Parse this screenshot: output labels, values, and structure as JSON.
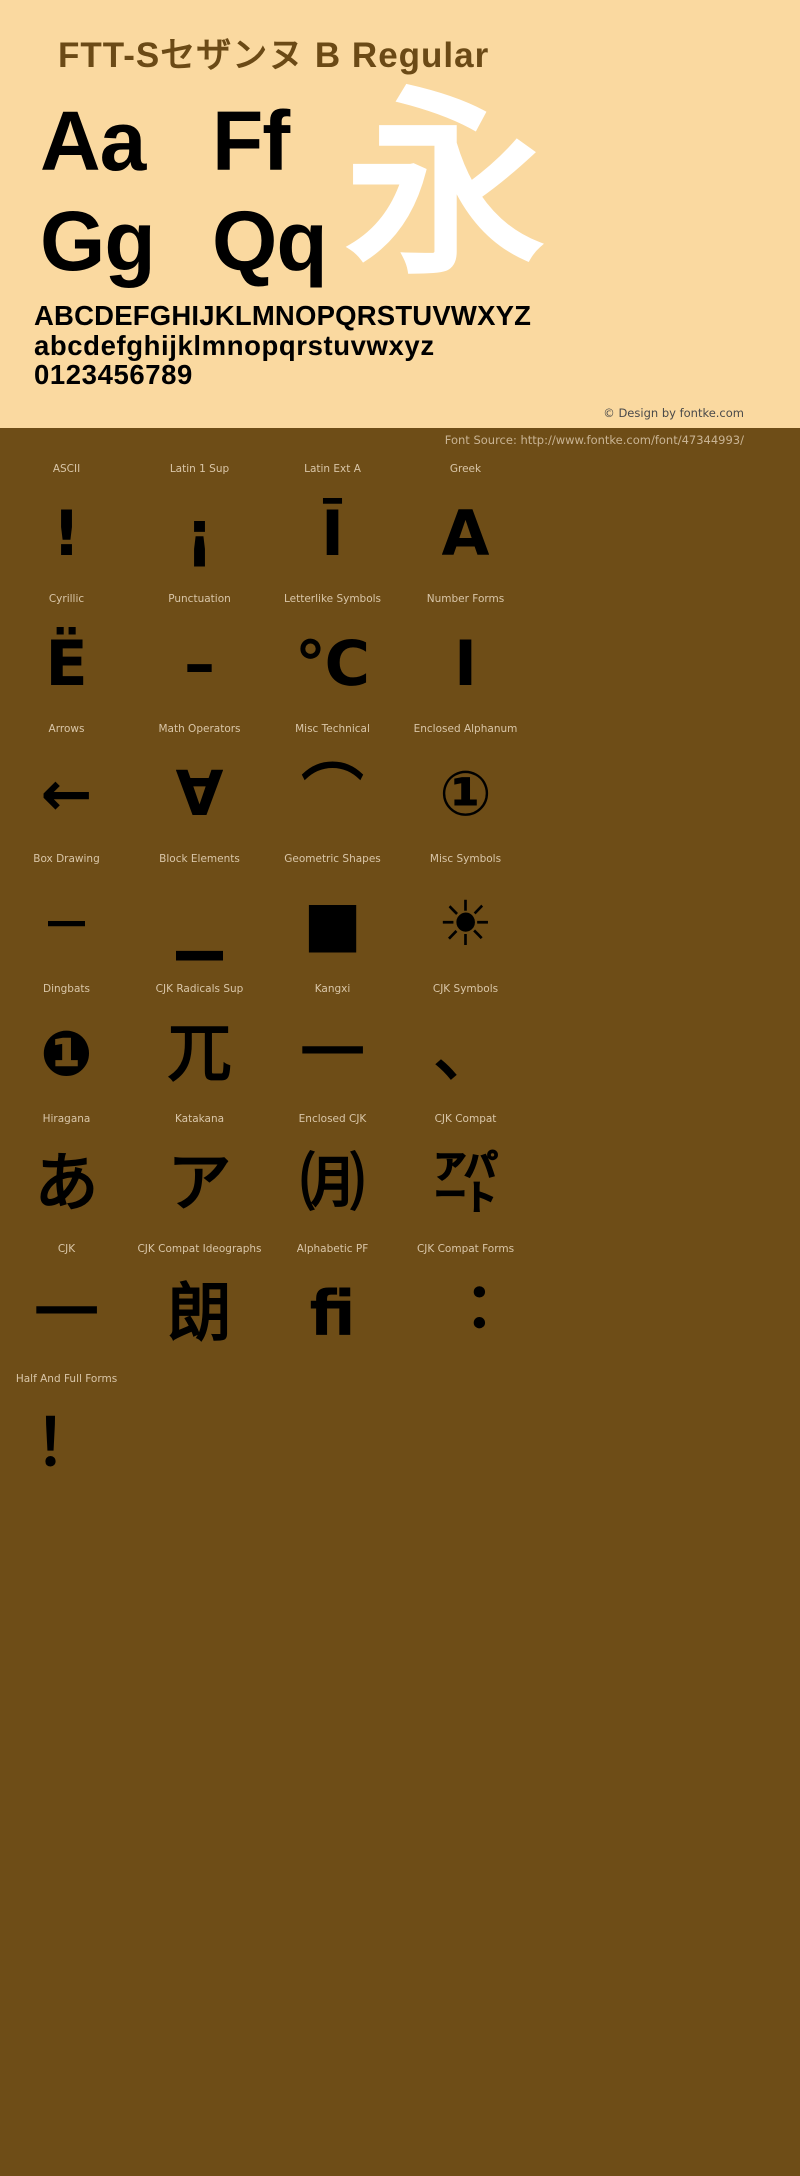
{
  "header": {
    "title": "FTT-Sセザンヌ B Regular"
  },
  "specimen": {
    "pairs": [
      {
        "name": "aa",
        "text": "Aa"
      },
      {
        "name": "ff",
        "text": "Ff"
      },
      {
        "name": "gg",
        "text": "Gg"
      },
      {
        "name": "qq",
        "text": "Qq"
      }
    ],
    "cjk_sample": "永",
    "uppercase": "ABCDEFGHIJKLMNOPQRSTUVWXYZ",
    "lowercase": "abcdefghijklmnopqrstuvwxyz",
    "digits": "0123456789"
  },
  "credit": {
    "design": "© Design by fontke.com",
    "source": "Font Source: http://www.fontke.com/font/47344993/"
  },
  "colors": {
    "hero_background": "#fad9a0",
    "title_color": "#6b4a16",
    "panel_background": "#6e4d17",
    "label_color": "#d9c6a8",
    "glyph_color": "#000000",
    "cjk_sample_color": "#ffffff"
  },
  "unicode_blocks": [
    [
      {
        "label": "ASCII",
        "glyph": "!"
      },
      {
        "label": "Latin 1 Sup",
        "glyph": "¡"
      },
      {
        "label": "Latin Ext A",
        "glyph": "Ī"
      },
      {
        "label": "Greek",
        "glyph": "Α"
      }
    ],
    [
      {
        "label": "Cyrillic",
        "glyph": "Ё"
      },
      {
        "label": "Punctuation",
        "glyph": "–"
      },
      {
        "label": "Letterlike Symbols",
        "glyph": "℃"
      },
      {
        "label": "Number Forms",
        "glyph": "Ⅰ"
      }
    ],
    [
      {
        "label": "Arrows",
        "glyph": "←"
      },
      {
        "label": "Math Operators",
        "glyph": "∀"
      },
      {
        "label": "Misc Technical",
        "glyph": "⌒"
      },
      {
        "label": "Enclosed Alphanum",
        "glyph": "①"
      }
    ],
    [
      {
        "label": "Box Drawing",
        "glyph": "─"
      },
      {
        "label": "Block Elements",
        "glyph": "▁"
      },
      {
        "label": "Geometric Shapes",
        "glyph": "■"
      },
      {
        "label": "Misc Symbols",
        "glyph": "☀"
      }
    ],
    [
      {
        "label": "Dingbats",
        "glyph": "❶"
      },
      {
        "label": "CJK Radicals Sup",
        "glyph": "兀"
      },
      {
        "label": "Kangxi",
        "glyph": "一"
      },
      {
        "label": "CJK Symbols",
        "glyph": "、"
      }
    ],
    [
      {
        "label": "Hiragana",
        "glyph": "あ"
      },
      {
        "label": "Katakana",
        "glyph": "ア"
      },
      {
        "label": "Enclosed CJK",
        "glyph": "㈪"
      },
      {
        "label": "CJK Compat",
        "glyph": "㌀"
      }
    ],
    [
      {
        "label": "CJK",
        "glyph": "一"
      },
      {
        "label": "CJK Compat Ideographs",
        "glyph": "朗"
      },
      {
        "label": "Alphabetic PF",
        "glyph": "ﬁ"
      },
      {
        "label": "CJK Compat Forms",
        "glyph": "︓"
      }
    ],
    [
      {
        "label": "Half And Full Forms",
        "glyph": "！"
      }
    ]
  ]
}
